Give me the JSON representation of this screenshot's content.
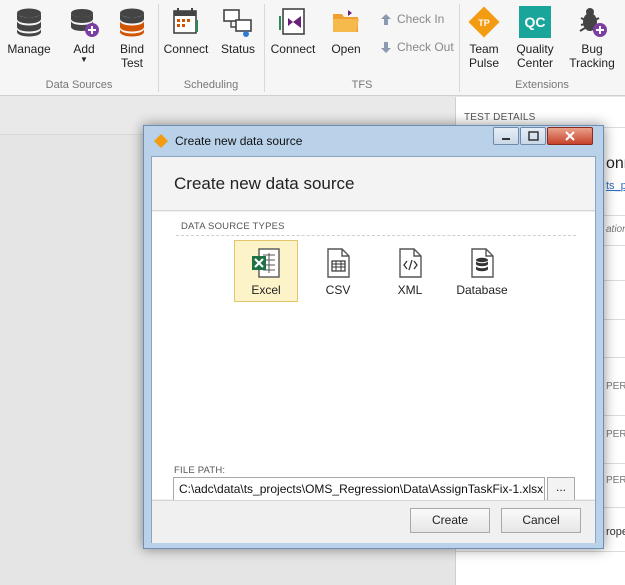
{
  "ribbon": {
    "manage": "Manage",
    "add": "Add",
    "bind_test": "Bind Test",
    "data_sources_group": "Data Sources",
    "connect_scheduling": "Connect",
    "status": "Status",
    "scheduling_group": "Scheduling",
    "connect_tfs": "Connect",
    "open": "Open",
    "check_in": "Check In",
    "check_out": "Check Out",
    "tfs_group": "TFS",
    "team_pulse": "Team Pulse",
    "team_pulse_badge": "TP",
    "quality_center": "Quality Center",
    "quality_center_badge": "QC",
    "bug_tracking": "Bug Tracking",
    "extensions_group": "Extensions"
  },
  "right_panel": {
    "header": "TEST DETAILS",
    "frag1": "onn",
    "frag2": "ts_p",
    "frag3": "ation",
    "frag4": "PERT",
    "frag5": "PERT",
    "frag6": "PERT",
    "frag7": "rope"
  },
  "dialog": {
    "window_title": "Create new data source",
    "header_title": "Create new data source",
    "types_label": "DATA SOURCE TYPES",
    "types": [
      {
        "label": "Excel",
        "icon": "excel-icon"
      },
      {
        "label": "CSV",
        "icon": "csv-icon"
      },
      {
        "label": "XML",
        "icon": "xml-icon"
      },
      {
        "label": "Database",
        "icon": "database-icon"
      }
    ],
    "selected_type": "Excel",
    "file_path_label": "FILE PATH:",
    "file_path_value": "C:\\adc\\data\\ts_projects\\OMS_Regression\\Data\\AssignTaskFix-1.xlsx",
    "browse_label": "...",
    "create_label": "Create",
    "cancel_label": "Cancel"
  },
  "colors": {
    "team_pulse": "#f39c12",
    "quality_center": "#1aa59a",
    "selection_fill": "#fdf3c8",
    "dialog_frame": "#b9d2ea"
  }
}
